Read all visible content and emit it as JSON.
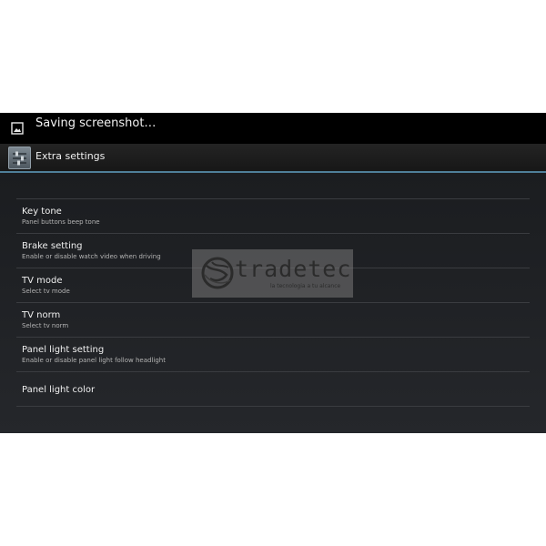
{
  "notification": {
    "text": "Saving screenshot…",
    "icon": "image-icon"
  },
  "action_bar": {
    "title": "Extra settings",
    "icon": "settings-sliders-icon",
    "accent_color": "#4f7f99"
  },
  "settings": [
    {
      "title": "Key tone",
      "summary": "Panel buttons beep tone"
    },
    {
      "title": "Brake setting",
      "summary": "Enable or disable watch video when driving"
    },
    {
      "title": "TV mode",
      "summary": "Select tv mode"
    },
    {
      "title": "TV norm",
      "summary": "Select tv norm"
    },
    {
      "title": "Panel light setting",
      "summary": "Enable or disable panel light follow headlight"
    },
    {
      "title": "Panel light color",
      "summary": ""
    }
  ],
  "watermark": {
    "brand": "tradetec",
    "tagline": "la tecnologia a tu alcance"
  }
}
